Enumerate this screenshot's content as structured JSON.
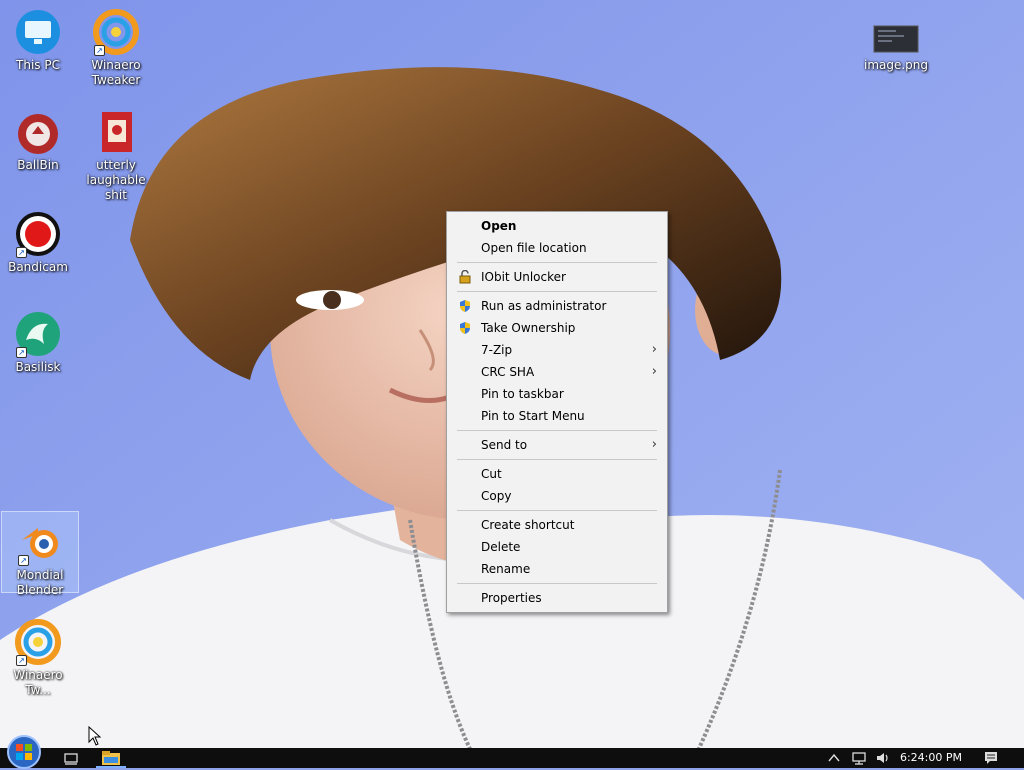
{
  "desktop": {
    "icons": [
      {
        "label": "This PC",
        "icon": "this-pc-icon"
      },
      {
        "label": "Winaero Tweaker",
        "icon": "winaero-tweaker-icon"
      },
      {
        "label": "BallBin",
        "icon": "recycle-bin-icon"
      },
      {
        "label": "utterly laughable shit",
        "icon": "document-icon"
      },
      {
        "label": "Bandicam",
        "icon": "bandicam-icon"
      },
      {
        "label": "Basilisk",
        "icon": "basilisk-browser-icon"
      },
      {
        "label": "Mondial Blender",
        "icon": "blender-icon"
      },
      {
        "label": "Winaero Tw...",
        "icon": "winaero-tweaker-icon"
      },
      {
        "label": "image.png",
        "icon": "image-file-icon"
      }
    ],
    "selected_icon": "Mondial Blender"
  },
  "context_menu": {
    "items": [
      {
        "label": "Open",
        "bold": true
      },
      {
        "label": "Open file location"
      },
      {
        "label": "IObit Unlocker",
        "icon": "unlocker-icon"
      },
      {
        "label": "Run as administrator",
        "icon": "uac-shield-icon"
      },
      {
        "label": "Take Ownership",
        "icon": "uac-shield-icon"
      },
      {
        "label": "7-Zip",
        "submenu": true
      },
      {
        "label": "CRC SHA",
        "submenu": true
      },
      {
        "label": "Pin to taskbar"
      },
      {
        "label": "Pin to Start Menu"
      },
      {
        "label": "Send to",
        "submenu": true
      },
      {
        "label": "Cut"
      },
      {
        "label": "Copy"
      },
      {
        "label": "Create shortcut"
      },
      {
        "label": "Delete"
      },
      {
        "label": "Rename"
      },
      {
        "label": "Properties"
      }
    ],
    "submenu_arrow": "›"
  },
  "taskbar": {
    "start_icon": "windows-start-orb-icon",
    "task_view_icon": "task-view-icon",
    "explorer_icon": "file-explorer-icon",
    "tray": {
      "chevron_icon": "chevron-up-icon",
      "network_icon": "network-icon",
      "volume_icon": "volume-icon",
      "time": "6:24:00 PM",
      "notification_icon": "action-center-icon"
    }
  },
  "colors": {
    "wallpaper_sky": "#8fa3ea",
    "menu_bg": "#f2f2f2",
    "taskbar_bg": "#0e0e0e"
  }
}
